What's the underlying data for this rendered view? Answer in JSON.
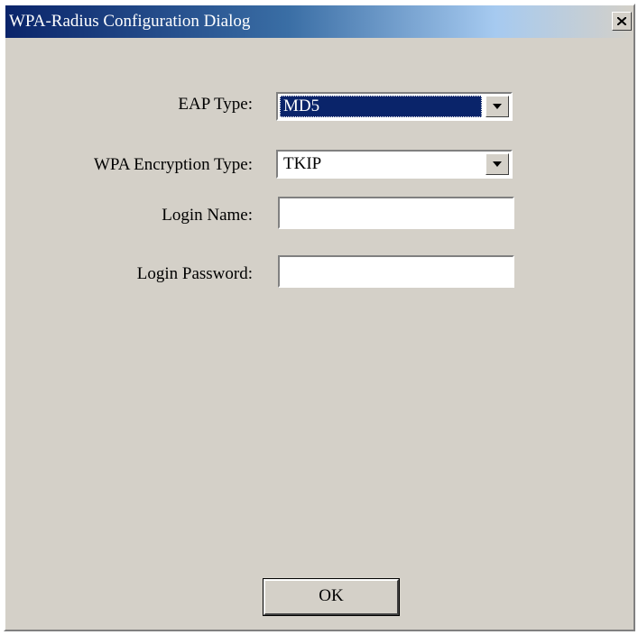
{
  "window": {
    "title": "WPA-Radius Configuration Dialog",
    "close_icon": "close-icon"
  },
  "form": {
    "eap_type": {
      "label": "EAP Type:",
      "value": "MD5"
    },
    "wpa_encryption_type": {
      "label": "WPA Encryption Type:",
      "value": "TKIP"
    },
    "login_name": {
      "label": "Login Name:",
      "value": ""
    },
    "login_password": {
      "label": "Login Password:",
      "value": ""
    }
  },
  "buttons": {
    "ok_label": "OK"
  },
  "colors": {
    "dialog_face": "#d4d0c8",
    "titlebar_start": "#0a246a",
    "titlebar_end": "#a6caf0",
    "selection": "#0a246a"
  }
}
